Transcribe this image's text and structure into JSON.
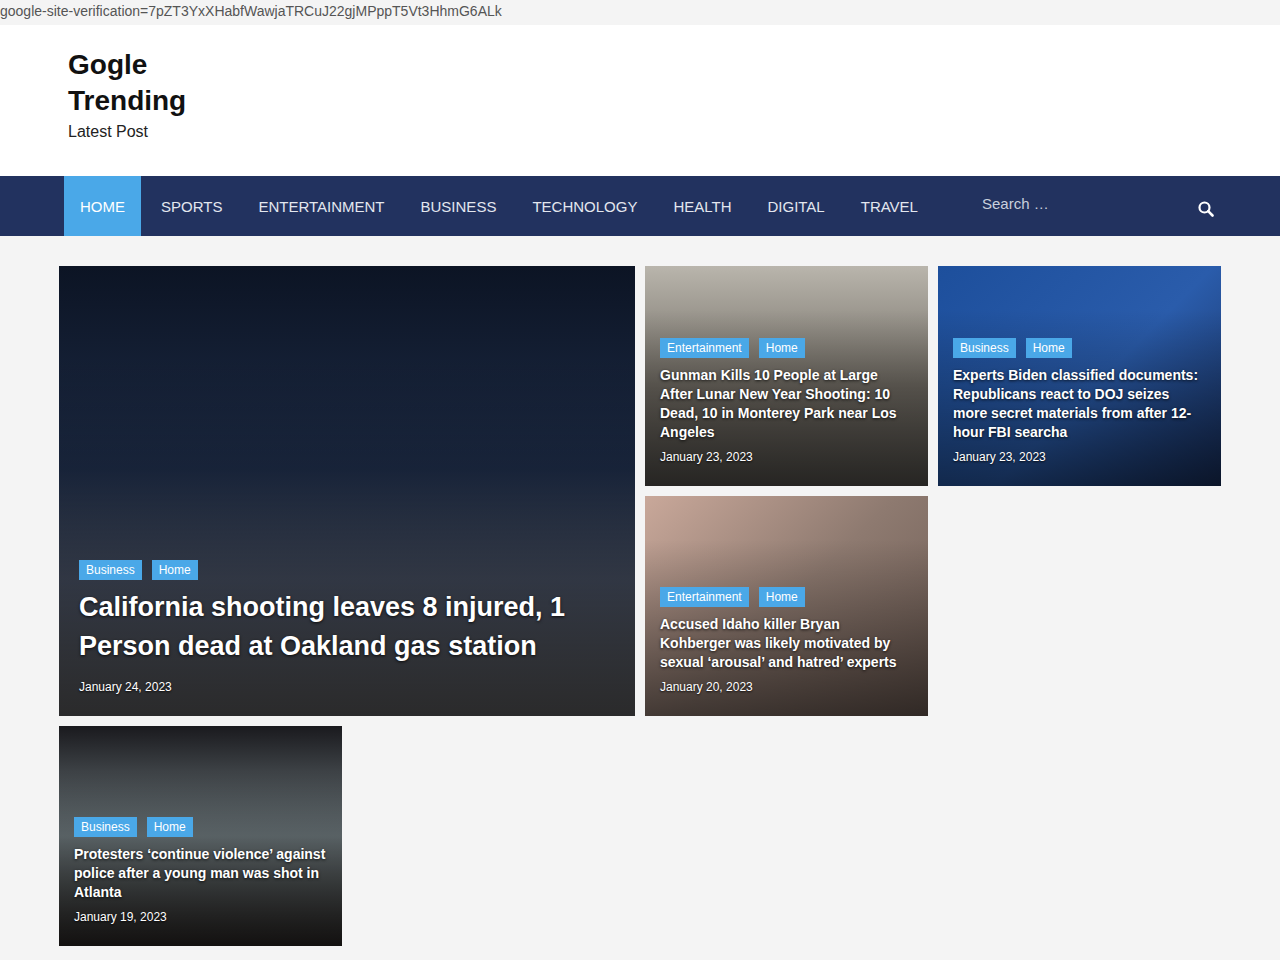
{
  "page": {
    "verification": "google-site-verification=7pZT3YxXHabfWawjaTRCuJ22gjMPppT5Vt3HhmG6ALk"
  },
  "header": {
    "title": "Gogle Trending",
    "tagline": "Latest Post"
  },
  "nav": {
    "items": [
      {
        "label": "HOME",
        "selected": true
      },
      {
        "label": "SPORTS",
        "selected": false
      },
      {
        "label": "ENTERTAINMENT",
        "selected": false
      },
      {
        "label": "BUSINESS",
        "selected": false
      },
      {
        "label": "TECHNOLOGY",
        "selected": false
      },
      {
        "label": "HEALTH",
        "selected": false
      },
      {
        "label": "DIGITAL",
        "selected": false
      },
      {
        "label": "TRAVEL",
        "selected": false
      }
    ],
    "search": {
      "placeholder": "Search …"
    }
  },
  "posts": [
    {
      "categories": [
        "Business",
        "Home"
      ],
      "title": "California shooting leaves 8 injured, 1 Person dead at Oakland gas station",
      "date": "January 24, 2023"
    },
    {
      "categories": [
        "Entertainment",
        "Home"
      ],
      "title": "Gunman Kills 10 People at Large After Lunar New Year Shooting: 10 Dead, 10 in Monterey Park near Los Angeles",
      "date": "January 23, 2023"
    },
    {
      "categories": [
        "Business",
        "Home"
      ],
      "title": "Experts Biden classified documents: Republicans react to DOJ seizes more secret materials from after 12-hour FBI searcha",
      "date": "January 23, 2023"
    },
    {
      "categories": [
        "Entertainment",
        "Home"
      ],
      "title": "Accused Idaho killer Bryan Kohberger was likely motivated by sexual ‘arousal’ and hatred’ experts",
      "date": "January 20, 2023"
    },
    {
      "categories": [
        "Business",
        "Home"
      ],
      "title": "Protesters ‘continue violence’ against police after a young man was shot in Atlanta",
      "date": "January 19, 2023"
    }
  ]
}
